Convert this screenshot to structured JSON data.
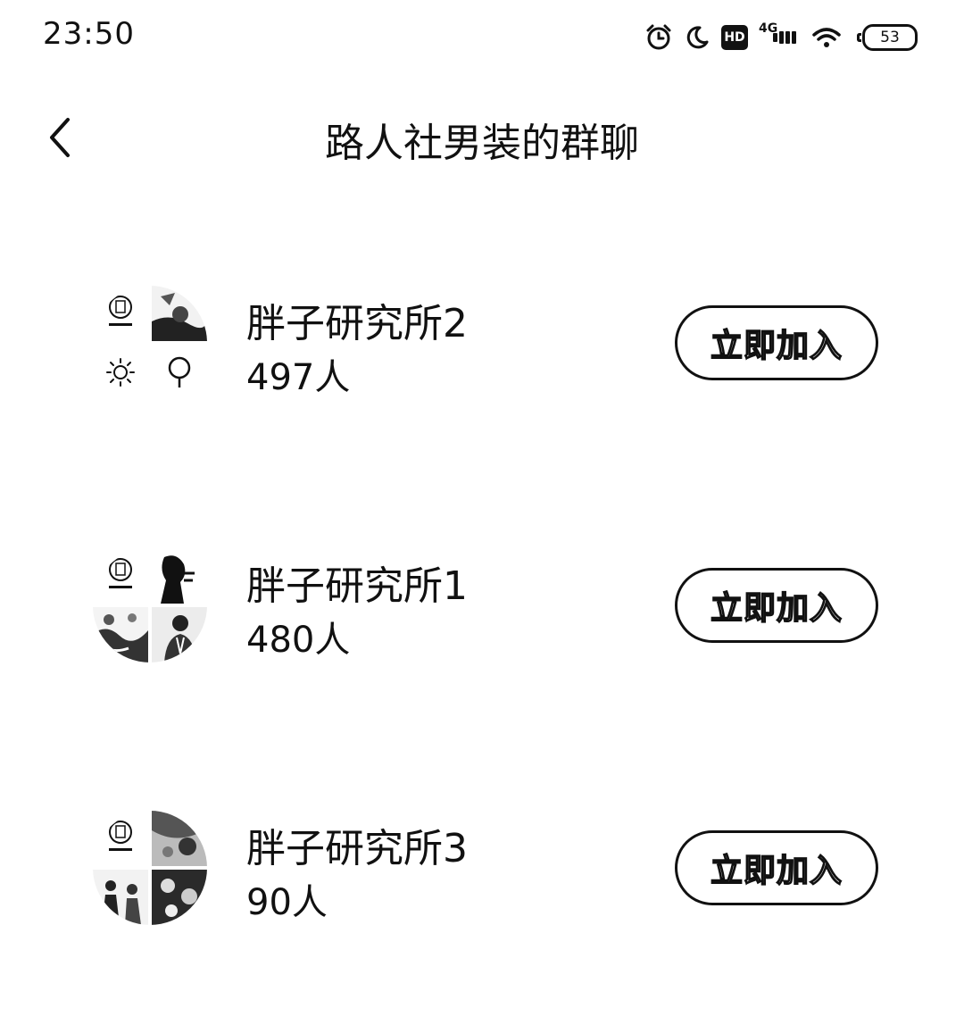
{
  "status_bar": {
    "time": "23:50",
    "icons": [
      "alarm-icon",
      "moon-icon",
      "hd-icon",
      "4g-signal-icon",
      "wifi-icon",
      "battery-icon"
    ],
    "hd_label": "HD",
    "network_label": "4G",
    "battery_level": "53"
  },
  "header": {
    "back_icon": "chevron-left-icon",
    "title": "路人社男装的群聊"
  },
  "groups": [
    {
      "name": "胖子研究所2",
      "members": "497人",
      "join_label": "立即加入"
    },
    {
      "name": "胖子研究所1",
      "members": "480人",
      "join_label": "立即加入"
    },
    {
      "name": "胖子研究所3",
      "members": "90人",
      "join_label": "立即加入"
    }
  ],
  "colors": {
    "text": "#111111",
    "background": "#ffffff"
  }
}
